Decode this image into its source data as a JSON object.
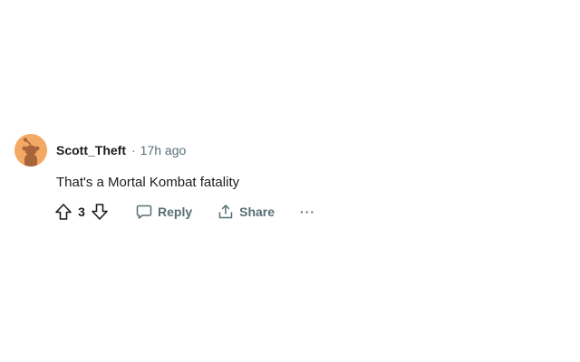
{
  "comment": {
    "username": "Scott_Theft",
    "separator": "·",
    "timestamp": "17h ago",
    "text": "That's a Mortal Kombat fatality",
    "score": "3",
    "reply_label": "Reply",
    "share_label": "Share",
    "more_label": "···"
  },
  "icons": {
    "upvote": "upvote-arrow-icon",
    "downvote": "downvote-arrow-icon",
    "reply": "speech-bubble-icon",
    "share": "share-upload-icon",
    "avatar": "snoo-avatar"
  },
  "colors": {
    "avatar_bg": "#f3a964",
    "avatar_figure": "#a8653c",
    "muted_text": "#576f76",
    "text": "#1c1c1c"
  }
}
